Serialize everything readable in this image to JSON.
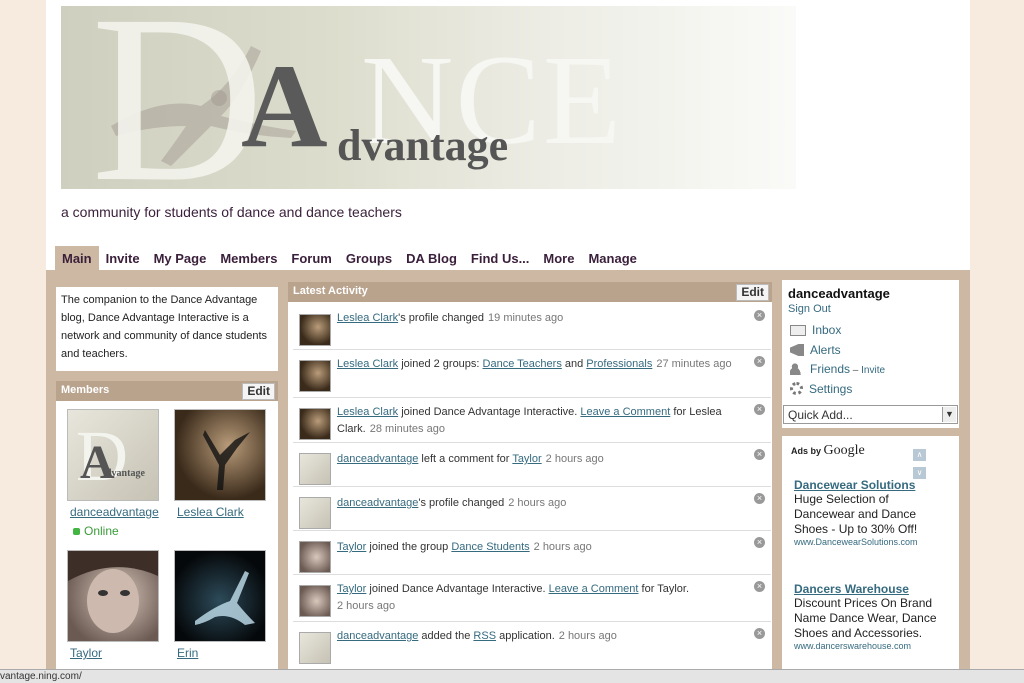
{
  "banner": {
    "letter_d": "D",
    "letter_a": "A",
    "ance": "NCE",
    "dvantage": "dvantage"
  },
  "tagline": "a community for students of dance and dance teachers",
  "nav": [
    "Main",
    "Invite",
    "My Page",
    "Members",
    "Forum",
    "Groups",
    "DA Blog",
    "Find Us...",
    "More",
    "Manage"
  ],
  "intro": "The companion to the Dance Advantage blog, Dance Advantage Interactive is a network and community of dance students and teachers.",
  "members": {
    "title": "Members",
    "edit": "Edit",
    "people": [
      {
        "name": "danceadvantage",
        "status": "Online"
      },
      {
        "name": "Leslea Clark"
      },
      {
        "name": "Taylor"
      },
      {
        "name": "Erin"
      }
    ]
  },
  "activity": {
    "title": "Latest Activity",
    "edit": "Edit",
    "items": [
      {
        "l1": "Leslea Clark",
        "t1": "'s profile changed",
        "time": "19 minutes ago"
      },
      {
        "l1": "Leslea Clark",
        "t1": " joined 2 groups: ",
        "l2": "Dance Teachers",
        "t2": " and ",
        "l3": "Professionals",
        "time": "27 minutes ago"
      },
      {
        "l1": "Leslea Clark",
        "t1": " joined Dance Advantage Interactive. ",
        "l2": "Leave a Comment",
        "t2": " for Leslea Clark.",
        "time": "28 minutes ago"
      },
      {
        "l1": "danceadvantage",
        "t1": " left a comment for ",
        "l2": "Taylor",
        "time": "2 hours ago"
      },
      {
        "l1": "danceadvantage",
        "t1": "'s profile changed",
        "time": "2 hours ago"
      },
      {
        "l1": "Taylor",
        "t1": " joined the group ",
        "l2": "Dance Students",
        "time": "2 hours ago"
      },
      {
        "l1": "Taylor",
        "t1": " joined Dance Advantage Interactive. ",
        "l2": "Leave a Comment",
        "t2": " for Taylor.",
        "time": "2 hours ago"
      },
      {
        "l1": "danceadvantage",
        "t1": " added the ",
        "l2": "RSS",
        "t2": " application.",
        "time": "2 hours ago"
      }
    ]
  },
  "user": {
    "name": "danceadvantage",
    "signout": "Sign Out",
    "inbox": "Inbox",
    "alerts": "Alerts",
    "friends": "Friends",
    "invite": "Invite",
    "settings": "Settings",
    "quickadd": "Quick Add..."
  },
  "ads": {
    "by": "Ads by",
    "google": "Google",
    "items": [
      {
        "title": "Dancewear Solutions",
        "body": "Huge Selection of Dancewear and Dance Shoes - Up to 30% Off!",
        "url": "www.DancewearSolutions.com"
      },
      {
        "title": "Dancers Warehouse",
        "body": "Discount Prices On Brand Name Dance Wear, Dance Shoes and Accessories.",
        "url": "www.dancerswarehouse.com"
      }
    ]
  },
  "status_url": "vantage.ning.com/",
  "colors": {
    "accent": "#cdb8a3",
    "header": "#b9a38d",
    "link": "#356a7f",
    "nav": "#3a1f3a"
  }
}
